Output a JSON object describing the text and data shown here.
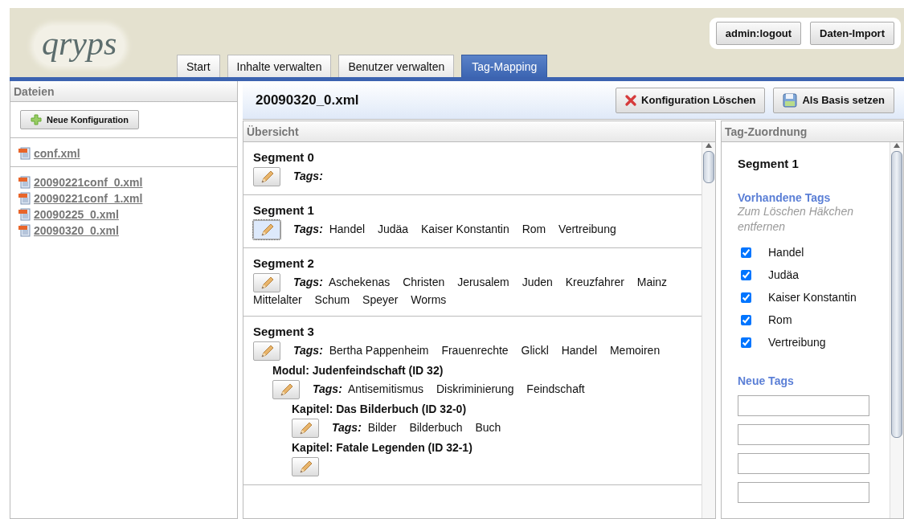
{
  "header": {
    "logo": "qryps",
    "tabs": [
      {
        "label": "Start",
        "selected": false
      },
      {
        "label": "Inhalte verwalten",
        "selected": false
      },
      {
        "label": "Benutzer verwalten",
        "selected": false
      },
      {
        "label": "Tag-Mapping",
        "selected": true
      }
    ],
    "buttons": [
      "admin:logout",
      "Daten-Import"
    ]
  },
  "sidebar": {
    "title": "Dateien",
    "new_button": "Neue Konfiguration",
    "file_groups": [
      [
        "conf.xml"
      ],
      [
        "20090221conf_0.xml",
        "20090221conf_1.xml",
        "20090225_0.xml",
        "20090320_0.xml"
      ]
    ]
  },
  "toolbar": {
    "title": "20090320_0.xml",
    "buttons": [
      {
        "label": "Konfiguration Löschen",
        "kind": "delete"
      },
      {
        "label": "Als Basis setzen",
        "kind": "save"
      }
    ]
  },
  "overview": {
    "title": "Übersicht",
    "segments": [
      {
        "title": "Segment 0",
        "selected": false,
        "tags_label": "Tags:"
      },
      {
        "title": "Segment 1",
        "selected": true,
        "tags_label": "Tags:",
        "tags": [
          "Handel",
          "Judäa",
          "Kaiser Konstantin",
          "Rom",
          "Vertreibung"
        ]
      },
      {
        "title": "Segment 2",
        "selected": false,
        "tags_label": "Tags:",
        "tags": [
          "Aschekenas",
          "Christen",
          "Jerusalem",
          "Juden",
          "Kreuzfahrer",
          "Mainz",
          "Mittelalter",
          "Schum",
          "Speyer",
          "Worms"
        ]
      },
      {
        "title": "Segment 3",
        "selected": false,
        "tags_label": "Tags:",
        "tags": [
          "Bertha Pappenheim",
          "Frauenrechte",
          "Glickl",
          "Handel",
          "Memoiren"
        ],
        "children": [
          {
            "title": "Modul: Judenfeindschaft (ID 32)",
            "selected": false,
            "tags_label": "Tags:",
            "tags": [
              "Antisemitismus",
              "Diskriminierung",
              "Feindschaft"
            ],
            "children": [
              {
                "title": "Kapitel: Das Bilderbuch (ID 32-0)",
                "selected": false,
                "tags_label": "Tags:",
                "tags": [
                  "Bilder",
                  "Bilderbuch",
                  "Buch"
                ]
              },
              {
                "title": "Kapitel: Fatale Legenden (ID 32-1)",
                "selected": false
              }
            ]
          }
        ]
      }
    ]
  },
  "tag_panel": {
    "title": "Tag-Zuordnung",
    "segment": "Segment 1",
    "existing_heading": "Vorhandene Tags",
    "hint": "Zum Löschen Häkchen entfernen",
    "tags": [
      {
        "label": "Handel",
        "checked": true
      },
      {
        "label": "Judäa",
        "checked": true
      },
      {
        "label": "Kaiser Konstantin",
        "checked": true
      },
      {
        "label": "Rom",
        "checked": true
      },
      {
        "label": "Vertreibung",
        "checked": true
      }
    ],
    "new_heading": "Neue Tags",
    "new_tag_fields": [
      {
        "kind": "text"
      },
      {
        "kind": "text"
      },
      {
        "kind": "text"
      },
      {
        "kind": "text"
      }
    ]
  }
}
